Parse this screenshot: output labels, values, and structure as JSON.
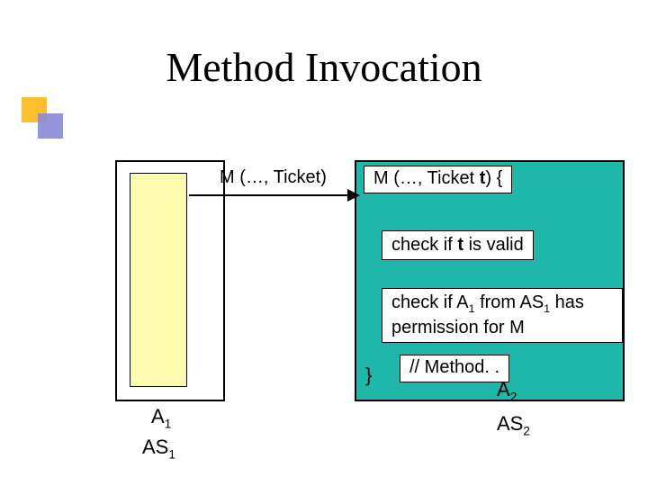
{
  "title": "Method Invocation",
  "caller_signature_prefix": "M (…, Ticket)",
  "callee_signature_prefix": "M (…, Ticket ",
  "callee_signature_param": "t",
  "callee_signature_suffix": ") {",
  "check1_pre": "check if ",
  "check1_t": "t",
  "check1_post": " is valid",
  "check2_pre": "check if A",
  "check2_sub1": "1",
  "check2_mid": " from AS",
  "check2_sub2": "1",
  "check2_post": " has permission for M",
  "method_comment": "// Method. .",
  "brace_close": "}",
  "label_a1_base": "A",
  "label_a1_sub": "1",
  "label_as1_base": "AS",
  "label_as1_sub": "1",
  "label_a2_base": "A",
  "label_a2_sub": "2",
  "label_as2_base": "AS",
  "label_as2_sub": "2",
  "chart_data": {
    "type": "diagram",
    "title": "Method Invocation",
    "nodes": [
      {
        "id": "A1",
        "container": "AS1",
        "role": "caller"
      },
      {
        "id": "A2",
        "container": "AS2",
        "role": "callee",
        "method_signature": "M (…, Ticket t)",
        "steps": [
          "check if t is valid",
          "check if A1 from AS1 has permission for M",
          "// Method. ."
        ]
      }
    ],
    "edges": [
      {
        "from": "A1",
        "to": "A2",
        "label": "M (…, Ticket)"
      }
    ]
  }
}
